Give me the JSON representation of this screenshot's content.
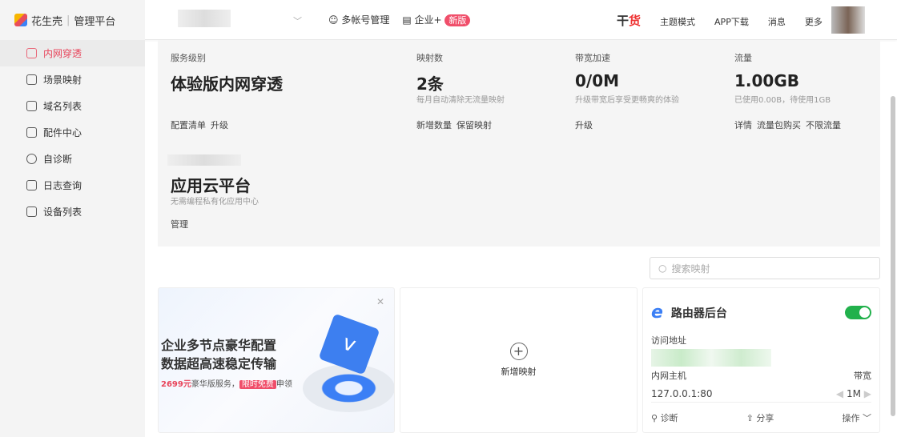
{
  "header": {
    "brand": "花生壳",
    "platform": "管理平台",
    "multi_account": "多帐号管理",
    "enterprise": "企业+",
    "new_badge": "新版",
    "ganhuo_a": "干",
    "ganhuo_b": "货",
    "theme": "主题模式",
    "app_download": "APP下载",
    "messages": "消息",
    "more": "更多"
  },
  "sidebar": {
    "items": [
      {
        "label": "内网穿透"
      },
      {
        "label": "场景映射"
      },
      {
        "label": "域名列表"
      },
      {
        "label": "配件中心"
      },
      {
        "label": "自诊断"
      },
      {
        "label": "日志查询"
      },
      {
        "label": "设备列表"
      }
    ]
  },
  "stats": [
    {
      "label": "服务级别",
      "value": "体验版内网穿透",
      "sub": "",
      "actions": [
        "配置清单",
        "升级"
      ]
    },
    {
      "label": "映射数",
      "value": "2条",
      "sub": "每月自动清除无流量映射",
      "actions": [
        "新增数量",
        "保留映射"
      ]
    },
    {
      "label": "带宽加速",
      "value": "0/0M",
      "sub": "升级带宽后享受更畅爽的体验",
      "actions": [
        "升级"
      ]
    },
    {
      "label": "流量",
      "value": "1.00GB",
      "sub": "已使用0.00B，待使用1GB",
      "actions": [
        "详情",
        "流量包购买",
        "不限流量"
      ]
    }
  ],
  "cloud": {
    "value": "应用云平台",
    "sub": "无需编程私有化应用中心",
    "action": "管理"
  },
  "search": {
    "placeholder": "搜索映射"
  },
  "ad": {
    "line1": "企业多节点豪华配置",
    "line2": "数据超高速稳定传输",
    "price": "2699元",
    "desc": "豪华版服务，",
    "free": "限时免费",
    "claim": "申领"
  },
  "add_mapping": "新增映射",
  "mapping": {
    "name": "路由器后台",
    "enabled": true,
    "access_label": "访问地址",
    "host_label": "内网主机",
    "bandwidth_label": "带宽",
    "host": "127.0.0.1:80",
    "bandwidth": "1M",
    "diagnose": "诊断",
    "share": "分享",
    "operate": "操作"
  }
}
